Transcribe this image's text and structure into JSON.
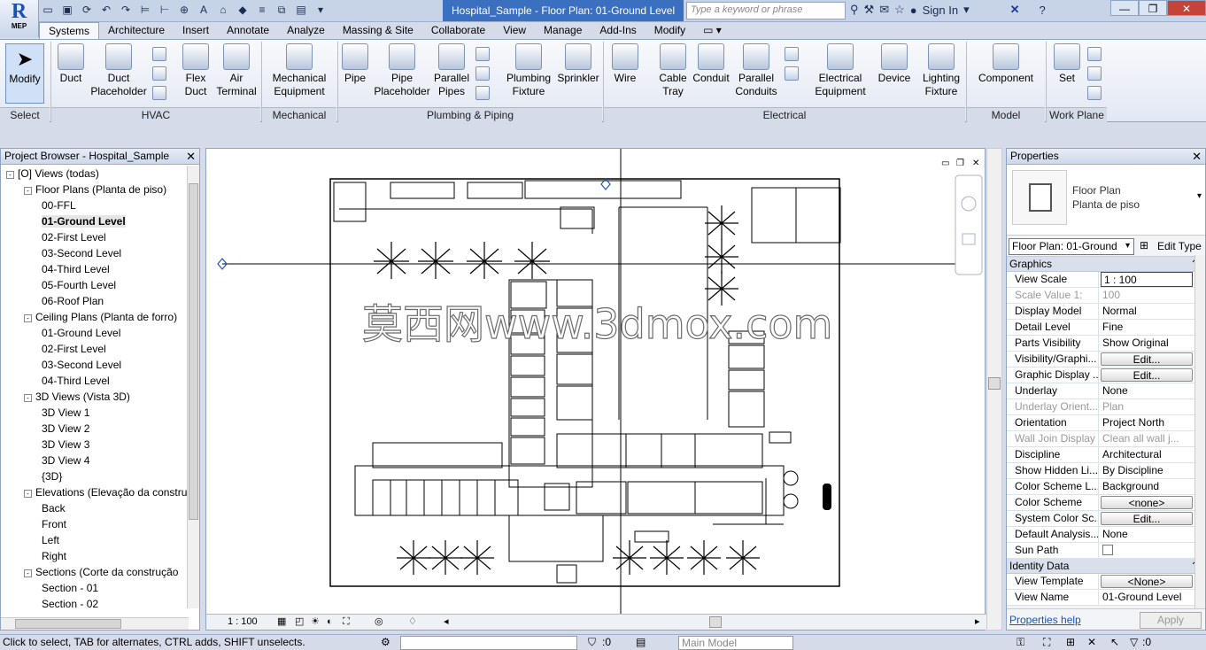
{
  "app": {
    "product": "MEP",
    "document_title": "Hospital_Sample - Floor Plan: 01-Ground Level"
  },
  "search": {
    "placeholder": "Type a keyword or phrase"
  },
  "account": {
    "sign_in": "Sign In"
  },
  "tabs": [
    "Systems",
    "Architecture",
    "Insert",
    "Annotate",
    "Analyze",
    "Massing & Site",
    "Collaborate",
    "View",
    "Manage",
    "Add-Ins",
    "Modify"
  ],
  "ribbon": {
    "modify": "Modify",
    "hvac": [
      "Duct",
      "Duct Placeholder",
      "Flex Duct",
      "Air Terminal"
    ],
    "mechanical": [
      "Mechanical Equipment"
    ],
    "plumbing": [
      "Pipe",
      "Pipe Placeholder",
      "Parallel Pipes",
      "Plumbing Fixture",
      "Sprinkler"
    ],
    "electrical": [
      "Wire",
      "Cable Tray",
      "Conduit",
      "Parallel Conduits",
      "Electrical Equipment",
      "Device",
      "Lighting Fixture"
    ],
    "model": [
      "Component"
    ],
    "workplane": [
      "Set"
    ],
    "groups": {
      "select": "Select",
      "hvac": "HVAC",
      "mechanical": "Mechanical",
      "plumbing": "Plumbing & Piping",
      "electrical": "Electrical",
      "model": "Model",
      "workplane": "Work Plane"
    }
  },
  "project_browser": {
    "title": "Project Browser - Hospital_Sample",
    "nodes": [
      {
        "label": "Views (todas)",
        "level": 0,
        "exp": "-"
      },
      {
        "label": "Floor Plans (Planta de piso)",
        "level": 1,
        "exp": "-"
      },
      {
        "label": "00-FFL",
        "level": 2
      },
      {
        "label": "01-Ground Level",
        "level": 2,
        "selected": true
      },
      {
        "label": "02-First Level",
        "level": 2
      },
      {
        "label": "03-Second Level",
        "level": 2
      },
      {
        "label": "04-Third Level",
        "level": 2
      },
      {
        "label": "05-Fourth Level",
        "level": 2
      },
      {
        "label": "06-Roof Plan",
        "level": 2
      },
      {
        "label": "Ceiling Plans (Planta de forro)",
        "level": 1,
        "exp": "-"
      },
      {
        "label": "01-Ground Level",
        "level": 2
      },
      {
        "label": "02-First Level",
        "level": 2
      },
      {
        "label": "03-Second Level",
        "level": 2
      },
      {
        "label": "04-Third Level",
        "level": 2
      },
      {
        "label": "3D Views (Vista 3D)",
        "level": 1,
        "exp": "-"
      },
      {
        "label": "3D View 1",
        "level": 2
      },
      {
        "label": "3D View 2",
        "level": 2
      },
      {
        "label": "3D View 3",
        "level": 2
      },
      {
        "label": "3D View 4",
        "level": 2
      },
      {
        "label": "{3D}",
        "level": 2
      },
      {
        "label": "Elevations (Elevação da constru",
        "level": 1,
        "exp": "-"
      },
      {
        "label": "Back",
        "level": 2
      },
      {
        "label": "Front",
        "level": 2
      },
      {
        "label": "Left",
        "level": 2
      },
      {
        "label": "Right",
        "level": 2
      },
      {
        "label": "Sections (Corte da construção",
        "level": 1,
        "exp": "-"
      },
      {
        "label": "Section - 01",
        "level": 2
      },
      {
        "label": "Section - 02",
        "level": 2
      }
    ]
  },
  "view": {
    "scale": "1 : 100",
    "watermark": "莫西网www.3dmox.com"
  },
  "properties": {
    "title": "Properties",
    "type_line1": "Floor Plan",
    "type_line2": "Planta de piso",
    "selector": "Floor Plan: 01-Ground",
    "edit_type": "Edit Type",
    "graphics_group": "Graphics",
    "rows": [
      {
        "k": "View Scale",
        "v": "1 : 100",
        "kind": "inp"
      },
      {
        "k": "Scale Value    1:",
        "v": "100",
        "kind": "dis"
      },
      {
        "k": "Display Model",
        "v": "Normal"
      },
      {
        "k": "Detail Level",
        "v": "Fine"
      },
      {
        "k": "Parts Visibility",
        "v": "Show Original"
      },
      {
        "k": "Visibility/Graphi...",
        "v": "Edit...",
        "kind": "btn"
      },
      {
        "k": "Graphic Display ...",
        "v": "Edit...",
        "kind": "btn"
      },
      {
        "k": "Underlay",
        "v": "None"
      },
      {
        "k": "Underlay Orient...",
        "v": "Plan",
        "kind": "dis"
      },
      {
        "k": "Orientation",
        "v": "Project North"
      },
      {
        "k": "Wall Join Display",
        "v": "Clean all wall j...",
        "kind": "dis"
      },
      {
        "k": "Discipline",
        "v": "Architectural"
      },
      {
        "k": "Show Hidden Li...",
        "v": "By Discipline"
      },
      {
        "k": "Color Scheme L...",
        "v": "Background"
      },
      {
        "k": "Color Scheme",
        "v": "<none>",
        "kind": "btn"
      },
      {
        "k": "System Color Sc...",
        "v": "Edit...",
        "kind": "btn"
      },
      {
        "k": "Default Analysis...",
        "v": "None"
      },
      {
        "k": "Sun Path",
        "v": "",
        "kind": "chk"
      }
    ],
    "identity_group": "Identity Data",
    "identity_rows": [
      {
        "k": "View Template",
        "v": "<None>",
        "kind": "btn"
      },
      {
        "k": "View Name",
        "v": "01-Ground Level"
      }
    ],
    "help": "Properties help",
    "apply": "Apply"
  },
  "status": {
    "message": "Click to select, TAB for alternates, CTRL adds, SHIFT unselects.",
    "filter_count": ":0",
    "model": "Main Model",
    "sel_count": ":0"
  }
}
